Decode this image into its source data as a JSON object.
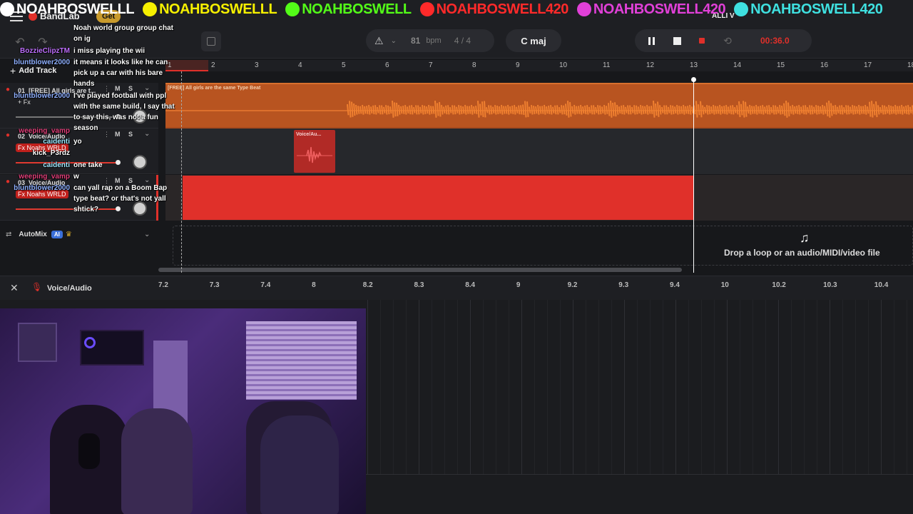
{
  "social": [
    {
      "icon": "x-icon",
      "text": "NOAHBOSWELLL",
      "color": "#ffffff"
    },
    {
      "icon": "snapchat-icon",
      "text": "NOAHBOSWELLL",
      "color": "#f6f000"
    },
    {
      "icon": "kick-icon",
      "text": "NOAHBOSWELL",
      "color": "#53fc18"
    },
    {
      "icon": "youtube-icon",
      "text": "NOAHBOSWELL420",
      "color": "#ff2a2a"
    },
    {
      "icon": "instagram-icon",
      "text": "NOAHBOSWELL420",
      "color": "#e140d8"
    },
    {
      "icon": "tiktok-icon",
      "text": "NOAHBOSWELL420",
      "color": "#3fe0e0"
    }
  ],
  "app": {
    "name": "BandLab",
    "get_label": "Get",
    "add_track_label": "Add Track",
    "account_label": "ALLI V"
  },
  "toolbar": {
    "bpm_value": "81",
    "bpm_unit": "bpm",
    "time_signature": "4 / 4",
    "key": "C maj",
    "time": "00:36.0"
  },
  "ruler_marks": [
    "1",
    "2",
    "3",
    "4",
    "5",
    "6",
    "7",
    "8",
    "9",
    "10",
    "11",
    "12",
    "13",
    "14",
    "15",
    "16",
    "17",
    "18"
  ],
  "tracks": [
    {
      "number": "01",
      "name": "[FREE] All girls are t...",
      "fx": "+ Fx",
      "clip_label": "[FREE] All girls are the same Type Beat"
    },
    {
      "number": "02",
      "name": "Voice/Audio",
      "fx": "Fx Noahs WRLD",
      "clip_label": "Voice/Au..."
    },
    {
      "number": "03",
      "name": "Voice/Audio",
      "fx": "Fx Noahs WRLD",
      "clip_label": ""
    }
  ],
  "automix": {
    "label": "AutoMix",
    "badge": "AI"
  },
  "drop_zone": {
    "text": "Drop a loop or an audio/MIDI/video file"
  },
  "editor": {
    "track_label": "Voice/Audio",
    "ticks": [
      "7.2",
      "7.3",
      "7.4",
      "8",
      "8.2",
      "8.3",
      "8.4",
      "9",
      "9.2",
      "9.3",
      "9.4",
      "10",
      "10.2",
      "10.3",
      "10.4"
    ]
  },
  "chat": [
    {
      "user": "",
      "user_color": "#ffffff",
      "message": "Noah world group group chat on ig"
    },
    {
      "user": "BozzieClipzTM",
      "user_color": "#c070ff",
      "message": "i miss playing the wii"
    },
    {
      "user": "bluntblower2000",
      "user_color": "#8fb0ff",
      "message": "it means it looks like he can pick up a car with his bare hands"
    },
    {
      "user": "bluntblower2000",
      "user_color": "#8fb0ff",
      "message": "I've played football with ppl with the same build, I say that to say this, was not a fun season"
    },
    {
      "user": "weeping_vamp",
      "user_color": "#e0407a",
      "message": ""
    },
    {
      "user": "caidenti",
      "user_color": "#a0e8ff",
      "message": "yo"
    },
    {
      "user": "kick_P3rdz",
      "user_color": "#ffffff",
      "message": ""
    },
    {
      "user": "caidenti",
      "user_color": "#a0e8ff",
      "message": "one take"
    },
    {
      "user": "weeping_vamp",
      "user_color": "#e0407a",
      "message": "w"
    },
    {
      "user": "bluntblower2000",
      "user_color": "#8fb0ff",
      "message": "can yall rap on a Boom Bap type beat? or that's not yall shtick?"
    }
  ]
}
